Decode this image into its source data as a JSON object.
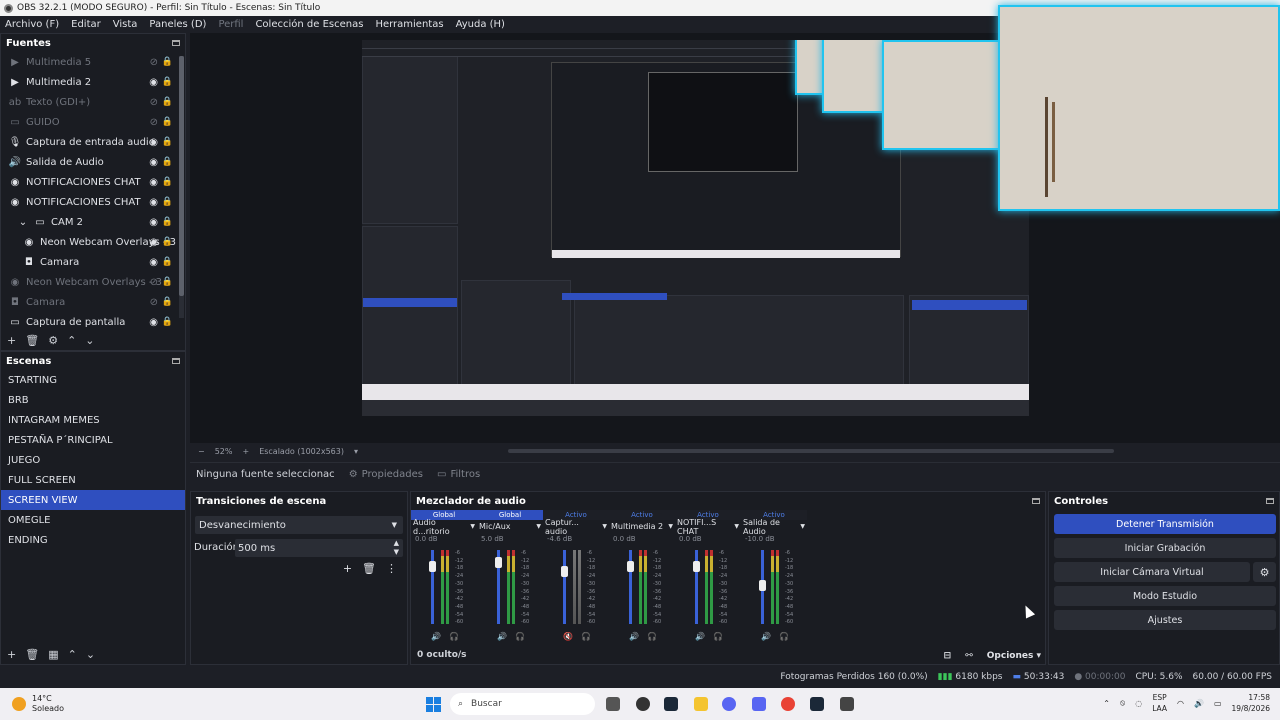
{
  "window": {
    "title": "OBS 32.2.1 (MODO SEGURO) - Perfil: Sin Título - Escenas: Sin Título"
  },
  "menu": [
    {
      "label": "Archivo (F)",
      "dim": false
    },
    {
      "label": "Editar",
      "dim": false
    },
    {
      "label": "Vista",
      "dim": false
    },
    {
      "label": "Paneles (D)",
      "dim": false
    },
    {
      "label": "Perfil",
      "dim": true
    },
    {
      "label": "Colección de Escenas",
      "dim": false
    },
    {
      "label": "Herramientas",
      "dim": false
    },
    {
      "label": "Ayuda (H)",
      "dim": false
    }
  ],
  "sources": {
    "title": "Fuentes",
    "items": [
      {
        "label": "Multimedia 5",
        "icon": "play-icon",
        "visible": false
      },
      {
        "label": "Multimedia 2",
        "icon": "play-icon",
        "visible": true
      },
      {
        "label": "Texto (GDI+)",
        "icon": "text-icon",
        "visible": false
      },
      {
        "label": "GUIDO",
        "icon": "folder-icon",
        "visible": false
      },
      {
        "label": "Captura de entrada audio",
        "icon": "mic-icon",
        "visible": true
      },
      {
        "label": "Salida de Audio",
        "icon": "speaker-icon",
        "visible": true
      },
      {
        "label": "NOTIFICACIONES CHAT",
        "icon": "globe-icon",
        "visible": true
      },
      {
        "label": "NOTIFICACIONES CHAT",
        "icon": "globe-icon",
        "visible": true
      },
      {
        "label": "CAM 2",
        "icon": "folder-icon",
        "visible": true,
        "group": true
      },
      {
        "label": "Neon Webcam Overlays - 3",
        "icon": "globe-icon",
        "visible": true,
        "child": true
      },
      {
        "label": "Camara",
        "icon": "camera-icon",
        "visible": true,
        "child": true
      },
      {
        "label": "Neon Webcam Overlays - 3",
        "icon": "globe-icon",
        "visible": false
      },
      {
        "label": "Camara",
        "icon": "camera-icon",
        "visible": false
      },
      {
        "label": "Captura de pantalla",
        "icon": "monitor-icon",
        "visible": true
      }
    ]
  },
  "scenes": {
    "title": "Escenas",
    "items": [
      "STARTING",
      "BRB",
      "INTAGRAM MEMES",
      "PESTAÑA P´RINCIPAL",
      "JUEGO",
      "FULL SCREEN",
      "SCREEN VIEW",
      "OMEGLE",
      "ENDING"
    ],
    "active_index": 6
  },
  "preview": {
    "zoom": "52%",
    "scale": "Escalado (1002x563)"
  },
  "properties_bar": {
    "no_source": "Ninguna fuente seleccionac",
    "properties": "Propiedades",
    "filters": "Filtros"
  },
  "transitions": {
    "title": "Transiciones de escena",
    "selected": "Desvanecimiento",
    "duration_label": "Duración",
    "duration_value": "500 ms"
  },
  "mixer": {
    "title": "Mezclador de audio",
    "hidden_label": "0 oculto/s",
    "options_label": "Opciones",
    "channels": [
      {
        "status": "Global",
        "name": "Audio d...ritorio",
        "db": "0.0 dB",
        "level": 0.85,
        "muted": false
      },
      {
        "status": "Global",
        "name": "Mic/Aux",
        "db": "5.0 dB",
        "level": 0.9,
        "muted": false
      },
      {
        "status": "Activo",
        "name": "Captur... audio",
        "db": "-4.6 dB",
        "level": 0.78,
        "muted": true
      },
      {
        "status": "Activo",
        "name": "Multimedia 2",
        "db": "0.0 dB",
        "level": 0.85,
        "muted": false
      },
      {
        "status": "Activo",
        "name": "NOTIFI...S CHAT",
        "db": "0.0 dB",
        "level": 0.85,
        "muted": false
      },
      {
        "status": "Activo",
        "name": "Salida de Audio",
        "db": "-10.0 dB",
        "level": 0.6,
        "muted": false
      }
    ],
    "meter_scale": [
      "-6",
      "-12",
      "-18",
      "-24",
      "-30",
      "-36",
      "-42",
      "-48",
      "-54",
      "-60"
    ]
  },
  "controls": {
    "title": "Controles",
    "stop_stream": "Detener Transmisión",
    "start_recording": "Iniciar Grabación",
    "start_virtual_cam": "Iniciar Cámara Virtual",
    "studio_mode": "Modo Estudio",
    "settings": "Ajustes"
  },
  "status": {
    "dropped_frames": "Fotogramas Perdidos 160 (0.0%)",
    "bitrate": "6180 kbps",
    "stream_time": "50:33:43",
    "rec_time": "00:00:00",
    "cpu": "CPU: 5.6%",
    "fps": "60.00 / 60.00 FPS"
  },
  "taskbar": {
    "temperature": "14°C",
    "weather": "Soleado",
    "search_placeholder": "Buscar",
    "lang1": "ESP",
    "lang2": "LAA",
    "time": "17:58",
    "date": "19/8/2026"
  },
  "colors": {
    "accent": "#2f4fbf",
    "neon": "#21c4ef",
    "meter_green": "#3cc65a"
  }
}
